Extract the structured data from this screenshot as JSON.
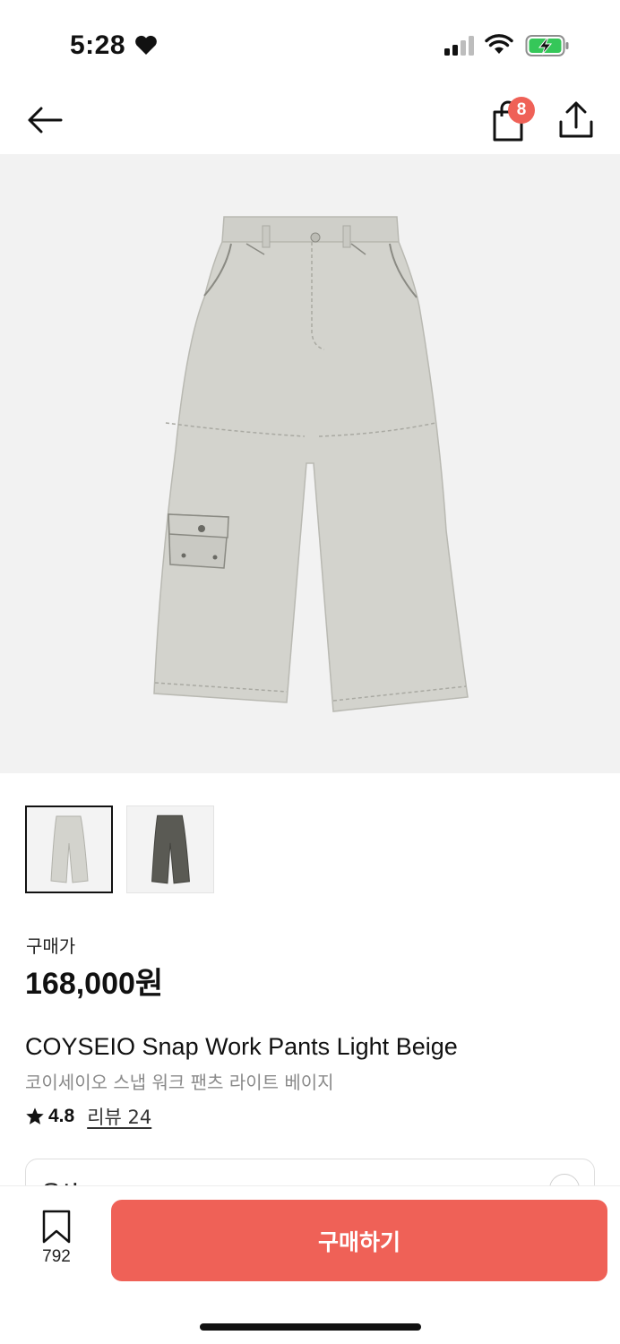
{
  "status_bar": {
    "time": "5:28"
  },
  "header": {
    "cart_count": "8"
  },
  "product": {
    "price_label": "구매가",
    "price": "168,000원",
    "name_en": "COYSEIO Snap Work Pants Light Beige",
    "name_ko": "코이세이오 스냅 워크 팬츠 라이트 베이지",
    "rating": "4.8",
    "review_link": "리뷰 24",
    "thumbnails": [
      {
        "color": "#d3d3cd",
        "selected": true
      },
      {
        "color": "#5a5a54",
        "selected": false
      }
    ]
  },
  "option": {
    "label": "옵션"
  },
  "bottom_bar": {
    "bookmark_count": "792",
    "buy_label": "구매하기"
  },
  "colors": {
    "accent": "#ef6157",
    "pants_light": "#d3d3cd",
    "pants_dark": "#5a5a54"
  }
}
